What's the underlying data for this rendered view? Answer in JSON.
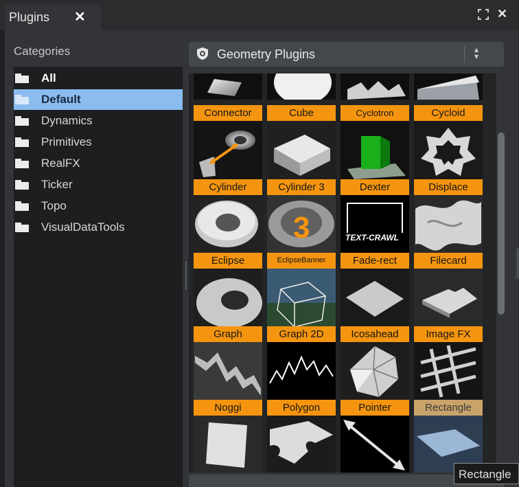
{
  "tab": {
    "title": "Plugins",
    "close": "✕"
  },
  "window": {
    "maximize": "⛶",
    "close": "✕"
  },
  "categories": {
    "title": "Categories",
    "items": [
      {
        "label": "All",
        "bold": true
      },
      {
        "label": "Default",
        "selected": true
      },
      {
        "label": "Dynamics"
      },
      {
        "label": "Primitives"
      },
      {
        "label": "RealFX"
      },
      {
        "label": "Ticker"
      },
      {
        "label": "Topo"
      },
      {
        "label": "VisualDataTools"
      }
    ]
  },
  "dropdown": {
    "label": "Geometry Plugins",
    "icon": "gear-shield-icon"
  },
  "plugins": [
    {
      "label": "Connector"
    },
    {
      "label": "Cube"
    },
    {
      "label": "Cyclotron"
    },
    {
      "label": "Cycloid"
    },
    {
      "label": "Cylinder"
    },
    {
      "label": "Cylinder 3"
    },
    {
      "label": "Dexter",
      "image_text": "TEXT-CRAWL"
    },
    {
      "label": "Displace"
    },
    {
      "label": "Eclipse"
    },
    {
      "label": "EclipseBanner"
    },
    {
      "label": "Fade-rect"
    },
    {
      "label": "Filecard"
    },
    {
      "label": "Graph"
    },
    {
      "label": "Graph 2D"
    },
    {
      "label": "Icosahead"
    },
    {
      "label": "Image FX"
    },
    {
      "label": "Noggi"
    },
    {
      "label": "Polygon"
    },
    {
      "label": "Pointer"
    },
    {
      "label": "Rectangle",
      "hovered": true
    }
  ],
  "tooltip": {
    "text": "Rectangle"
  },
  "colors": {
    "label_bg": "#f5950f",
    "selected_bg": "#8bbcef",
    "panel_bg": "#323437"
  }
}
